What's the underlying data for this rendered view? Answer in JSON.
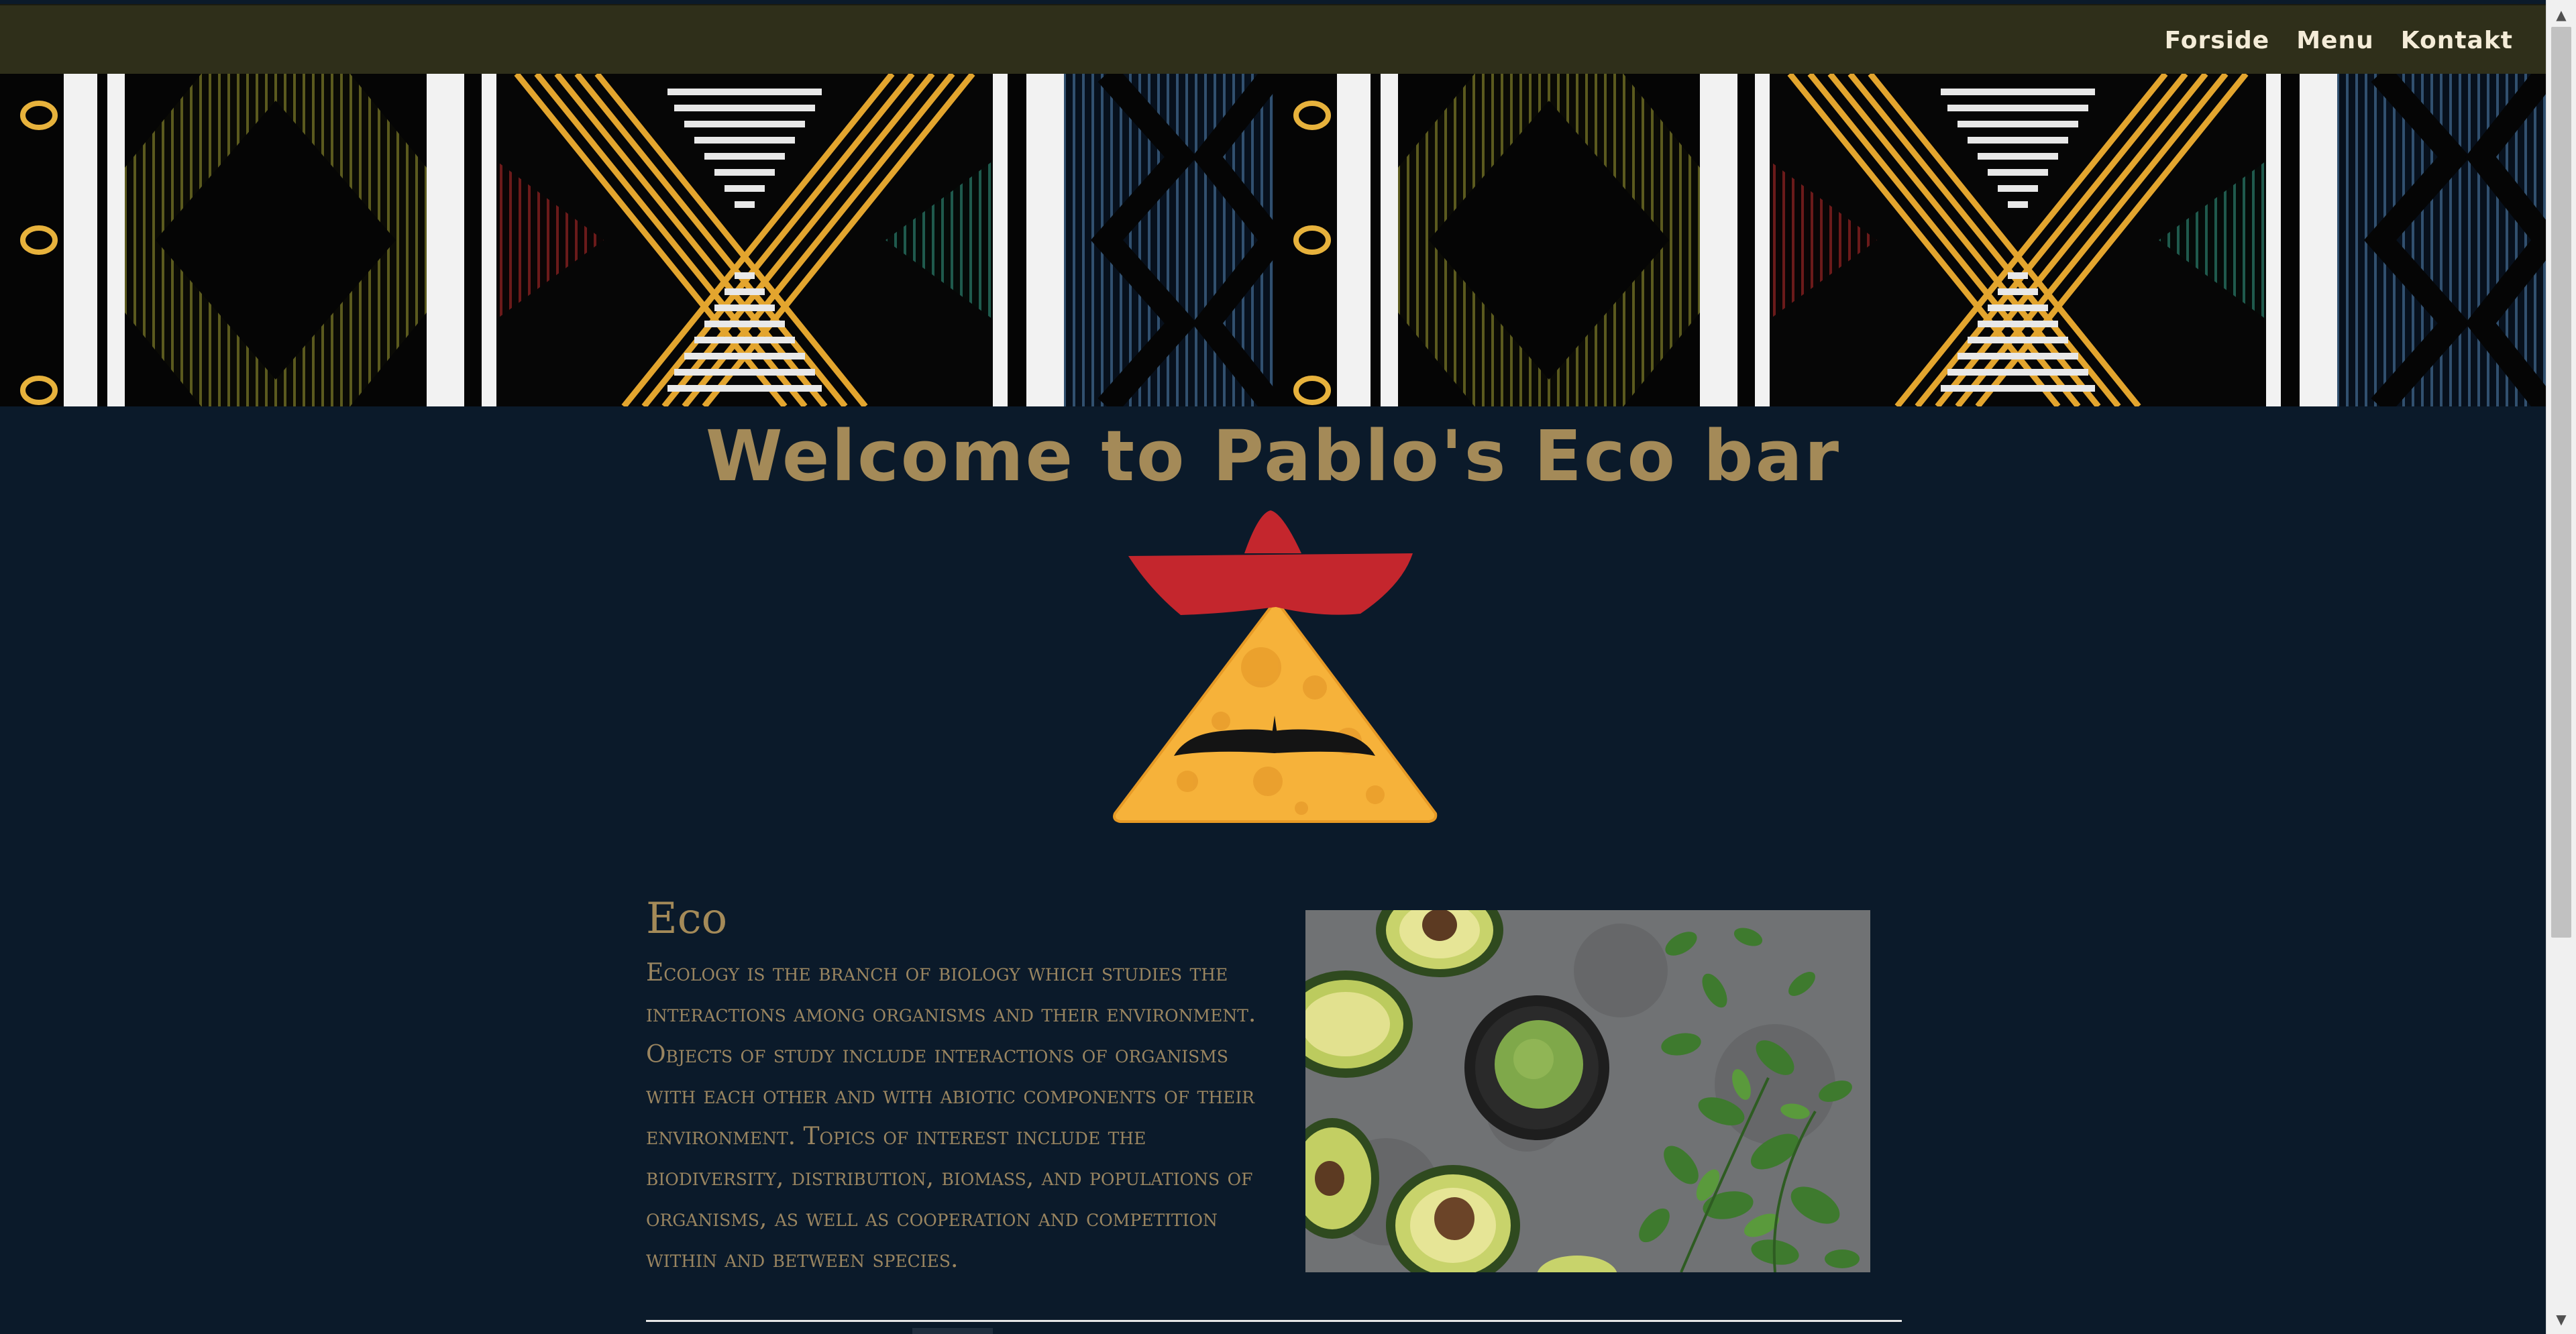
{
  "nav": {
    "items": [
      "Forside",
      "Menu",
      "Kontakt"
    ]
  },
  "main": {
    "title": "Welcome to Pablo's Eco bar",
    "section": {
      "heading": "Eco",
      "body": "Ecology is the branch of biology which studies the interactions among organisms and their environment. Objects of study include interactions of organisms with each other and with abiotic components of their environment. Topics of interest include the biodiversity, distribution, biomass, and populations of organisms, as well as cooperation and competition within and between species."
    }
  },
  "colors": {
    "nav_bg": "#2f2f1a",
    "page_bg": "#0b1a2a",
    "title_gold": "#a48a58",
    "nav_text": "#f4ecd8",
    "hat_red": "#c4262d",
    "chip_orange": "#f6b23a"
  }
}
